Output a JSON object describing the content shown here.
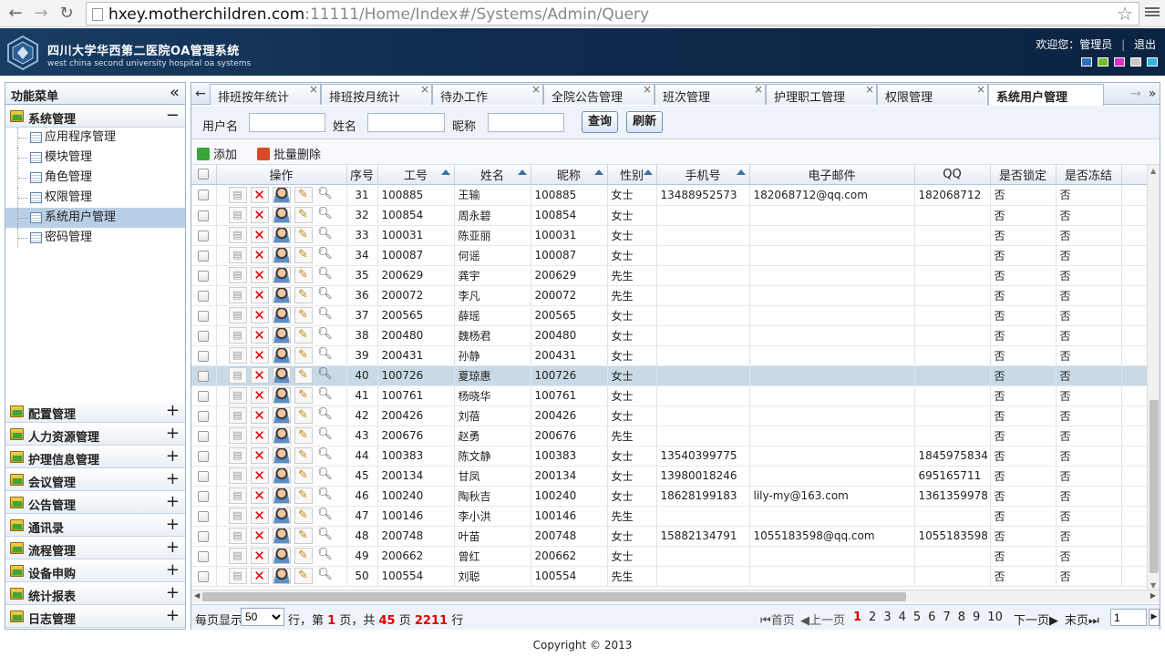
{
  "browser": {
    "url_host": "hxey.motherchildren.com",
    "url_rest": ":11111/Home/Index#/Systems/Admin/Query"
  },
  "header": {
    "title": "四川大学华西第二医院OA管理系统",
    "subtitle": "west china second university hospital oa systems",
    "welcome": "欢迎您：管理员",
    "logout": "退出",
    "skin_colors": [
      "#2f6fbf",
      "#6fbf2f",
      "#d92fc9",
      "#c8c8c8",
      "#2fb5e0"
    ]
  },
  "sidebar": {
    "title": "功能菜单",
    "collapse": "«",
    "active_group": "系统管理",
    "active_items": [
      "应用程序管理",
      "模块管理",
      "角色管理",
      "权限管理",
      "系统用户管理",
      "密码管理"
    ],
    "selected_item": "系统用户管理",
    "groups": [
      "配置管理",
      "人力资源管理",
      "护理信息管理",
      "会议管理",
      "公告管理",
      "通讯录",
      "流程管理",
      "设备申购",
      "统计报表",
      "日志管理"
    ]
  },
  "tabs": [
    "排班按年统计",
    "排班按月统计",
    "待办工作",
    "全院公告管理",
    "班次管理",
    "护理职工管理",
    "权限管理",
    "系统用户管理"
  ],
  "search": {
    "username_label": "用户名",
    "name_label": "姓名",
    "nickname_label": "昵称",
    "query_btn": "查询",
    "refresh_btn": "刷新"
  },
  "toolbar": {
    "add": "添加",
    "batch_delete": "批量删除"
  },
  "table": {
    "headers": [
      "操作",
      "序号",
      "工号",
      "姓名",
      "昵称",
      "性别",
      "手机号",
      "电子邮件",
      "QQ",
      "是否锁定",
      "是否冻结"
    ],
    "rows": [
      [
        "31",
        "100885",
        "王输",
        "100885",
        "女士",
        "13488952573",
        "182068712@qq.com",
        "182068712",
        "否",
        "否"
      ],
      [
        "32",
        "100854",
        "周永碧",
        "100854",
        "女士",
        "",
        "",
        "",
        "否",
        "否"
      ],
      [
        "33",
        "100031",
        "陈亚丽",
        "100031",
        "女士",
        "",
        "",
        "",
        "否",
        "否"
      ],
      [
        "34",
        "100087",
        "何谣",
        "100087",
        "女士",
        "",
        "",
        "",
        "否",
        "否"
      ],
      [
        "35",
        "200629",
        "龚宇",
        "200629",
        "先生",
        "",
        "",
        "",
        "否",
        "否"
      ],
      [
        "36",
        "200072",
        "李凡",
        "200072",
        "先生",
        "",
        "",
        "",
        "否",
        "否"
      ],
      [
        "37",
        "200565",
        "薛瑶",
        "200565",
        "女士",
        "",
        "",
        "",
        "否",
        "否"
      ],
      [
        "38",
        "200480",
        "魏杨君",
        "200480",
        "女士",
        "",
        "",
        "",
        "否",
        "否"
      ],
      [
        "39",
        "200431",
        "孙静",
        "200431",
        "女士",
        "",
        "",
        "",
        "否",
        "否"
      ],
      [
        "40",
        "100726",
        "夏琼惠",
        "100726",
        "女士",
        "",
        "",
        "",
        "否",
        "否"
      ],
      [
        "41",
        "100761",
        "杨晓华",
        "100761",
        "女士",
        "",
        "",
        "",
        "否",
        "否"
      ],
      [
        "42",
        "200426",
        "刘蓓",
        "200426",
        "女士",
        "",
        "",
        "",
        "否",
        "否"
      ],
      [
        "43",
        "200676",
        "赵勇",
        "200676",
        "先生",
        "",
        "",
        "",
        "否",
        "否"
      ],
      [
        "44",
        "100383",
        "陈文静",
        "100383",
        "女士",
        "13540399775",
        "",
        "1845975834",
        "否",
        "否"
      ],
      [
        "45",
        "200134",
        "甘凤",
        "200134",
        "女士",
        "13980018246",
        "",
        "695165711",
        "否",
        "否"
      ],
      [
        "46",
        "100240",
        "陶秋吉",
        "100240",
        "女士",
        "18628199183",
        "lily-my@163.com",
        "1361359978",
        "否",
        "否"
      ],
      [
        "47",
        "100146",
        "李小洪",
        "100146",
        "先生",
        "",
        "",
        "",
        "否",
        "否"
      ],
      [
        "48",
        "200748",
        "叶苗",
        "200748",
        "女士",
        "15882134791",
        "1055183598@qq.com",
        "1055183598",
        "否",
        "否"
      ],
      [
        "49",
        "200662",
        "曾红",
        "200662",
        "女士",
        "",
        "",
        "",
        "否",
        "否"
      ],
      [
        "50",
        "100554",
        "刘聪",
        "100554",
        "先生",
        "",
        "",
        "",
        "否",
        "否"
      ]
    ],
    "highlight_row": "40"
  },
  "pager": {
    "per_page_label": "每页显示",
    "per_page": "50",
    "mid_a": "行，第",
    "current": "1",
    "mid_b": "页，共",
    "total_pages": "45",
    "mid_c": "页",
    "total_rows": "2211",
    "end": "行",
    "first": "首页",
    "prev": "上一页",
    "pages": [
      "1",
      "2",
      "3",
      "4",
      "5",
      "6",
      "7",
      "8",
      "9",
      "10"
    ],
    "next": "下一页",
    "last": "末页",
    "goto": "1"
  },
  "footer": "Copyright © 2013"
}
